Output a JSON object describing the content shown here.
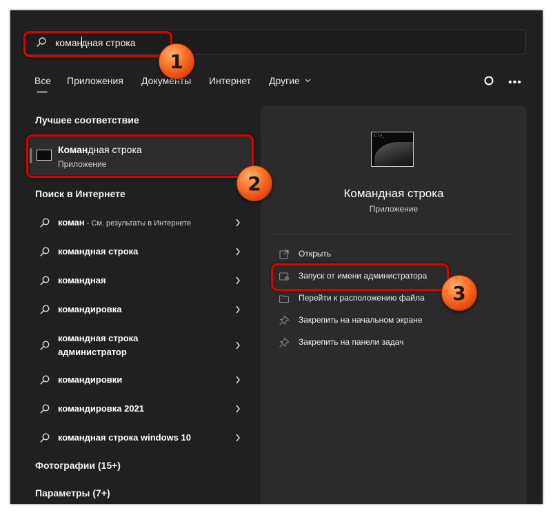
{
  "search": {
    "query_typed": "коман",
    "query_rest": "дная строка"
  },
  "tabs": [
    {
      "label": "Все",
      "active": true
    },
    {
      "label": "Приложения"
    },
    {
      "label": "Документы"
    },
    {
      "label": "Интернет"
    },
    {
      "label": "Другие"
    }
  ],
  "header_icons": {
    "circle": "circle-icon",
    "more": "more-icon",
    "more_glyph": "•••"
  },
  "best_match": {
    "section": "Лучшее соответствие",
    "name_bold": "Коман",
    "name_rest": "дная строка",
    "type": "Приложение",
    "icon": "cmd-icon"
  },
  "web": {
    "section": "Поиск в Интернете",
    "items": [
      {
        "bold": "коман",
        "rest": "",
        "hint": " - См. результаты в Интернете"
      },
      {
        "bold": "",
        "rest": "командная строка",
        "hint": ""
      },
      {
        "bold": "",
        "rest": "командная",
        "hint": ""
      },
      {
        "bold": "",
        "rest": "командировка",
        "hint": ""
      },
      {
        "bold": "",
        "rest": "командная строка",
        "line2": "администратор",
        "hint": ""
      },
      {
        "bold": "",
        "rest": "командировки",
        "hint": ""
      },
      {
        "bold": "",
        "rest": "командировка 2021",
        "hint": ""
      },
      {
        "bold": "",
        "rest": "командная строка windows 10",
        "hint": ""
      }
    ]
  },
  "photos": {
    "section": "Фотографии (15+)"
  },
  "settings": {
    "section": "Параметры (7+)"
  },
  "preview": {
    "title": "Командная строка",
    "type": "Приложение",
    "prompt_text": "C:\\>_",
    "actions": [
      {
        "label": "Открыть",
        "icon": "open-icon"
      },
      {
        "label": "Запуск от имени администратора",
        "icon": "shield-icon"
      },
      {
        "label": "Перейти к расположению файла",
        "icon": "folder-icon"
      },
      {
        "label": "Закрепить на начальном экране",
        "icon": "pin-icon"
      },
      {
        "label": "Закрепить на панели задач",
        "icon": "pin-icon"
      }
    ]
  },
  "annotations": {
    "badge_1": "1",
    "badge_2": "2",
    "badge_3": "3",
    "highlight_color": "#e00000",
    "badge_color": "#ff7a2e"
  }
}
